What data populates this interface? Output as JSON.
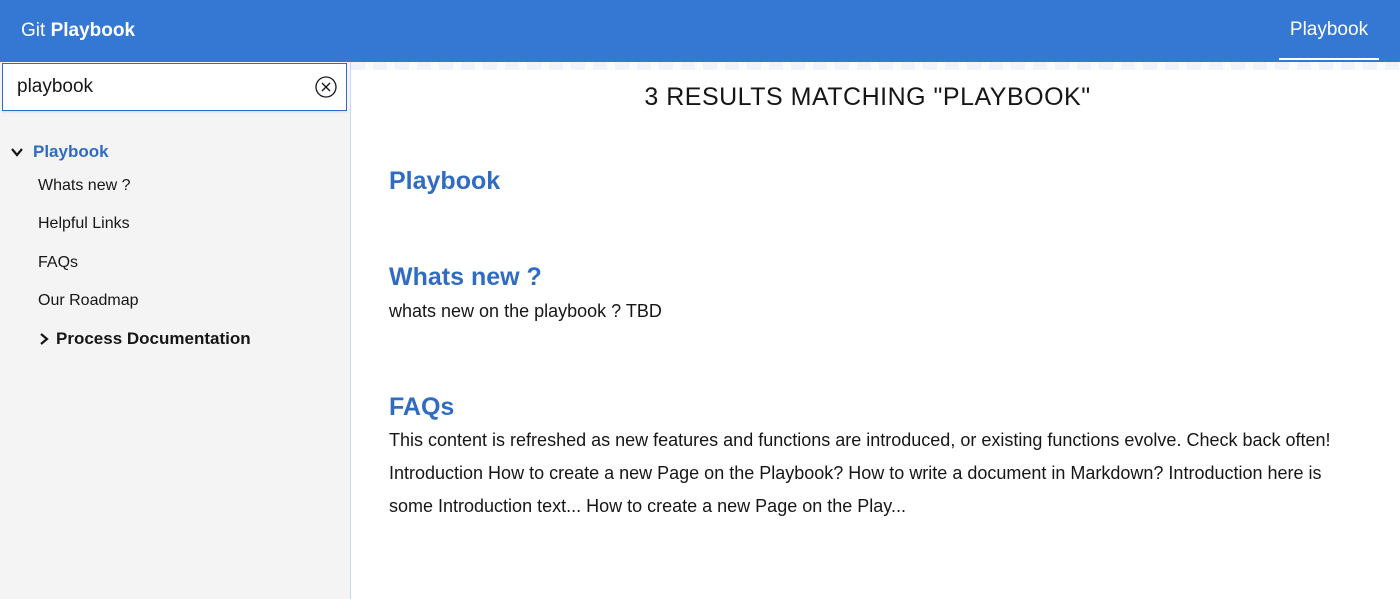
{
  "header": {
    "brand_prefix": "Git",
    "brand_name": "Playbook",
    "nav_tab": "Playbook"
  },
  "search": {
    "value": "playbook",
    "placeholder": ""
  },
  "sidebar": {
    "root": {
      "label": "Playbook",
      "expanded": true
    },
    "items": [
      {
        "label": "Whats new ?"
      },
      {
        "label": "Helpful Links"
      },
      {
        "label": "FAQs"
      },
      {
        "label": "Our Roadmap"
      }
    ],
    "subsection": {
      "label": "Process Documentation",
      "expanded": false
    }
  },
  "results": {
    "heading": "3 RESULTS MATCHING \"PLAYBOOK\"",
    "items": [
      {
        "title": "Playbook",
        "snippet": ""
      },
      {
        "title": "Whats new ?",
        "snippet": "whats new on the playbook ? TBD"
      },
      {
        "title": "FAQs",
        "snippet": "This content is refreshed as new features and functions are introduced, or existing functions evolve. Check back often! Introduction How to create a new Page on the Playbook? How to write a document in Markdown? Introduction here is some Introduction text... How to create a new Page on the Play..."
      }
    ]
  },
  "colors": {
    "header_bg": "#3478d4",
    "link": "#2f6cc2",
    "sidebar_bg": "#f4f4f4"
  }
}
